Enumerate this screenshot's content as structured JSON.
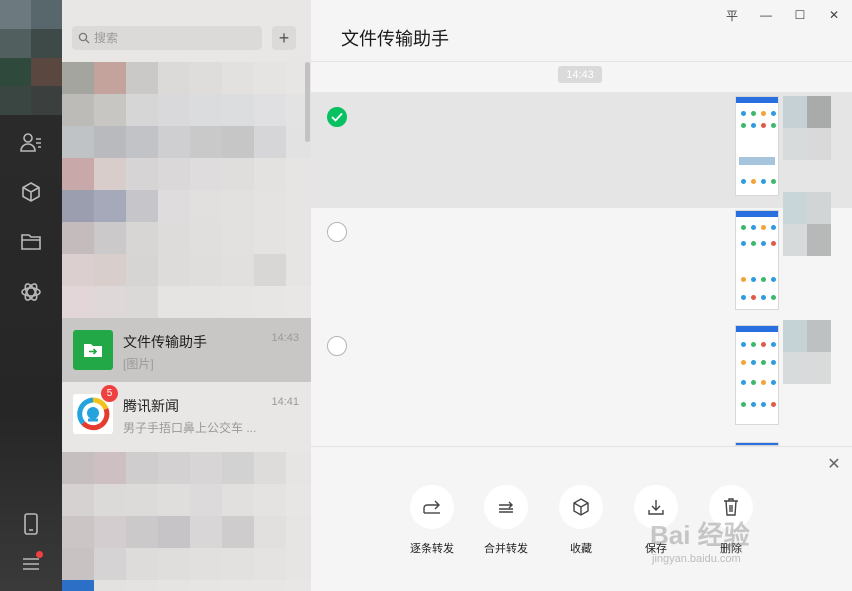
{
  "search": {
    "placeholder": "搜索",
    "add_label": "+"
  },
  "conversations": [
    {
      "name": "文件传输助手",
      "time": "14:43",
      "preview": "[图片]",
      "avatar_color": "#23a847"
    },
    {
      "name": "腾讯新闻",
      "time": "14:41",
      "preview": "男子手捂口鼻上公交车 ...",
      "badge": "5"
    }
  ],
  "chat": {
    "title": "文件传输助手",
    "timestamp": "14:43",
    "messages": [
      {
        "selected": true
      },
      {
        "selected": false
      },
      {
        "selected": false
      }
    ]
  },
  "window_controls": {
    "pin": "平",
    "minimize": "—",
    "maximize": "☐",
    "close": "✕"
  },
  "action_bar": {
    "close": "✕",
    "actions": [
      {
        "label": "逐条转发",
        "icon": "forward-icon"
      },
      {
        "label": "合并转发",
        "icon": "merge-forward-icon"
      },
      {
        "label": "收藏",
        "icon": "favorite-cube-icon"
      },
      {
        "label": "保存",
        "icon": "save-download-icon"
      },
      {
        "label": "删除",
        "icon": "trash-icon"
      }
    ]
  },
  "watermark": {
    "brand": "Bai 经验",
    "url": "jingyan.baidu.com"
  },
  "colors": {
    "accent_green": "#07c160",
    "badge_red": "#f04141",
    "rail_dark": "#2a2a2a"
  }
}
